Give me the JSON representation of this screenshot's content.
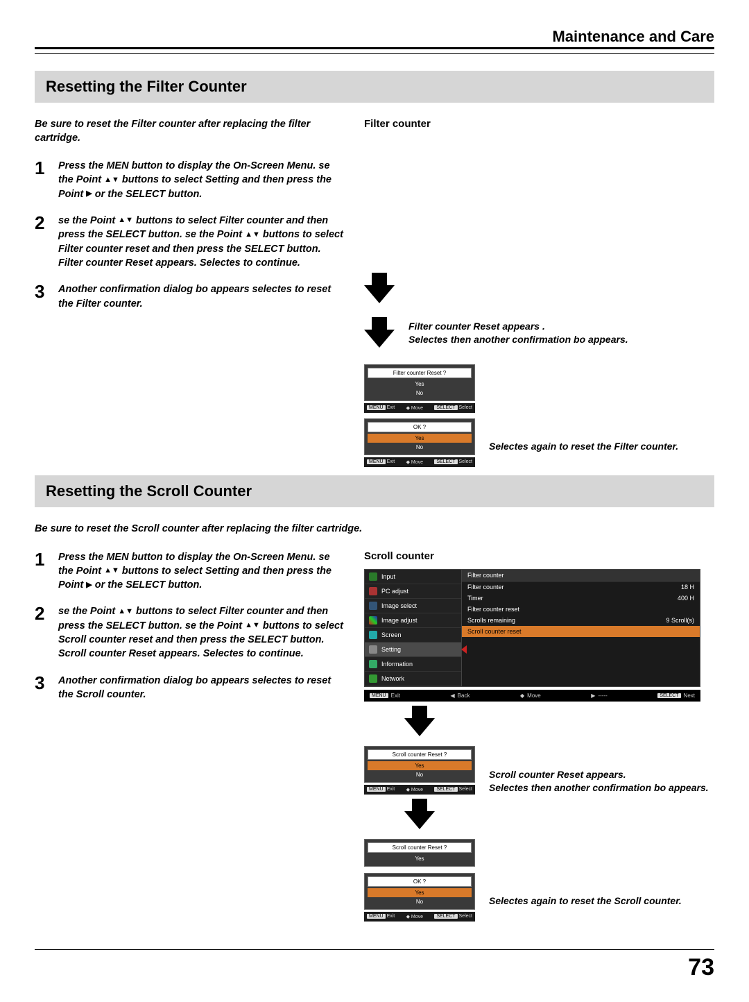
{
  "header": {
    "title": "Maintenance and Care"
  },
  "page_number": "73",
  "filter": {
    "bar": "Resetting the Filter Counter",
    "intro": "Be sure to reset the Filter counter after replacing the filter cartridge.",
    "step1a": "Press the MEN button to display the On-Screen Menu. se the Point ",
    "step1b": " buttons to select Setting and then press the Point ",
    "step1c": " or the SELECT    button.",
    "step2a": "se the Point ",
    "step2b": " buttons to select Filter counter and then press the SELECT button. se the Point ",
    "step2c": " buttons to select Filter counter reset and then press the SELECT button. Filter counter Reset appears. Selectes to continue.",
    "step3": "Another confirmation dialog bo appears selectes to reset the Filter counter.",
    "fig_heading": "Filter counter",
    "caption1": "Filter counter Reset appears .\nSelectes then another confirmation bo appears.",
    "caption2": "Selectes again to reset the Filter counter.",
    "dialog1": {
      "title": "Filter counter Reset ?",
      "opt_yes": "Yes",
      "opt_no": "No"
    },
    "dialog2": {
      "title": "OK ?",
      "opt_yes": "Yes",
      "opt_no": "No"
    },
    "nav": {
      "exit": "Exit",
      "move": "Move",
      "select": "Select",
      "menu": "MENU",
      "sel": "SELECT"
    }
  },
  "scroll": {
    "bar": "Resetting the Scroll Counter",
    "intro": "Be sure to reset the Scroll counter after replacing the filter cartridge.",
    "step1a": "Press the MEN button to display the On-Screen Menu. se the Point ",
    "step1b": " buttons to select Setting and then press the Point ",
    "step1c": " or the SELECT    button.",
    "step2a": "se the Point ",
    "step2b": " buttons to select Filter counter and then press the SELECT button. se the Point ",
    "step2c": " buttons to select Scroll counter reset and then press the SELECT button. Scroll counter Reset appears. Selectes to continue.",
    "step3": "Another confirmation dialog bo appears selectes to reset the Scroll counter.",
    "fig_heading": "Scroll counter",
    "menu": {
      "left": [
        "Input",
        "PC adjust",
        "Image select",
        "Image adjust",
        "Screen",
        "Setting",
        "Information",
        "Network"
      ],
      "right_header": "Filter counter",
      "rows": [
        {
          "l": "Filter counter",
          "r": "18 H"
        },
        {
          "l": "Timer",
          "r": "400 H"
        },
        {
          "l": "Filter counter reset",
          "r": ""
        },
        {
          "l": "Scrolls remaining",
          "r": "9  Scroll(s)"
        },
        {
          "l": "Scroll counter reset",
          "r": ""
        }
      ],
      "nav": {
        "exit": "Exit",
        "back": "Back",
        "move": "Move",
        "dash": "-----",
        "next": "Next",
        "menu": "MENU",
        "sel": "SELECT"
      }
    },
    "caption1": "Scroll counter Reset appears.\nSelectes then another confirmation bo appears.",
    "caption2": "Selectes again to reset the Scroll counter.",
    "dialog1": {
      "title": "Scroll counter Reset ?",
      "opt_yes": "Yes",
      "opt_no": "No"
    },
    "dialog2": {
      "title": "Scroll counter Reset ?",
      "opt_yes": "Yes"
    },
    "dialog3": {
      "title": "OK ?",
      "opt_yes": "Yes",
      "opt_no": "No"
    }
  }
}
